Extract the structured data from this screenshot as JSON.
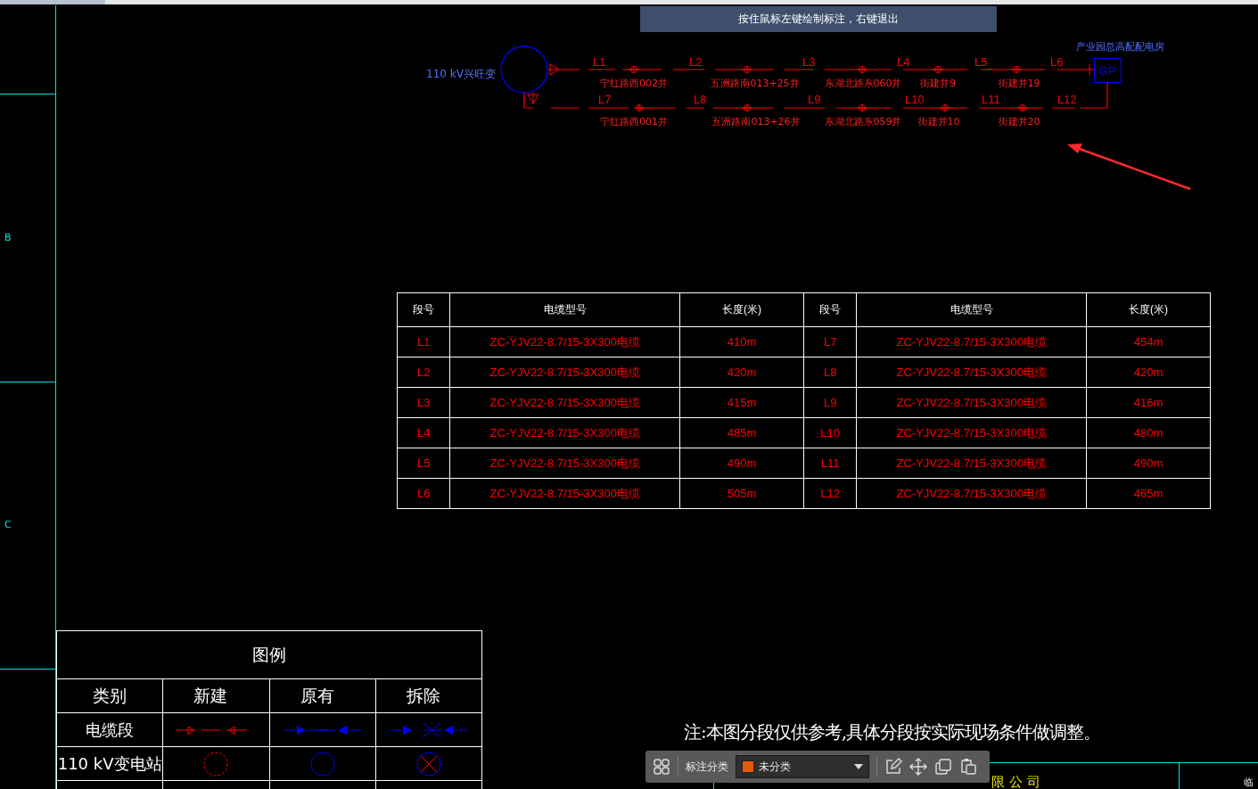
{
  "hint_banner": "按住鼠标左键绘制标注，右键退出",
  "frame": {
    "zone_labels": [
      "B",
      "C"
    ]
  },
  "diagram": {
    "source": "110 kV兴旺变",
    "destination": {
      "label": "产业园总高配配电房",
      "box": "GP"
    },
    "circuits": [
      {
        "segments": [
          "L1",
          "L2",
          "L3",
          "L4",
          "L5",
          "L6"
        ],
        "joints": [
          "宁红路西002井",
          "五洲路南013+25井",
          "东湖北路东060井",
          "街建井9",
          "街建井19"
        ]
      },
      {
        "segments": [
          "L7",
          "L8",
          "L9",
          "L10",
          "L11",
          "L12"
        ],
        "joints": [
          "宁红路西001井",
          "五洲路南013+26井",
          "东湖北路东059井",
          "街建井10",
          "街建井20"
        ]
      }
    ]
  },
  "cable_table": {
    "columns": [
      "段号",
      "电缆型号",
      "长度(米)",
      "段号",
      "电缆型号",
      "长度(米)"
    ],
    "rows": [
      [
        "L1",
        "ZC-YJV22-8.7/15-3X300电缆",
        "410m",
        "L7",
        "ZC-YJV22-8.7/15-3X300电缆",
        "454m"
      ],
      [
        "L2",
        "ZC-YJV22-8.7/15-3X300电缆",
        "420m",
        "L8",
        "ZC-YJV22-8.7/15-3X300电缆",
        "420m"
      ],
      [
        "L3",
        "ZC-YJV22-8.7/15-3X300电缆",
        "415m",
        "L9",
        "ZC-YJV22-8.7/15-3X300电缆",
        "416m"
      ],
      [
        "L4",
        "ZC-YJV22-8.7/15-3X300电缆",
        "485m",
        "L10",
        "ZC-YJV22-8.7/15-3X300电缆",
        "480m"
      ],
      [
        "L5",
        "ZC-YJV22-8.7/15-3X300电缆",
        "490m",
        "L11",
        "ZC-YJV22-8.7/15-3X300电缆",
        "490m"
      ],
      [
        "L6",
        "ZC-YJV22-8.7/15-3X300电缆",
        "505m",
        "L12",
        "ZC-YJV22-8.7/15-3X300电缆",
        "465m"
      ]
    ]
  },
  "legend": {
    "title": "图例",
    "columns": [
      "类别",
      "新建",
      "原有",
      "拆除"
    ],
    "rows": [
      {
        "label": "电缆段",
        "kind": "cable"
      },
      {
        "label": "110 kV变电站",
        "kind": "substation"
      }
    ]
  },
  "note": "注:本图分段仅供参考,具体分段按实际现场条件做调整。",
  "toolbar": {
    "label": "标注分类",
    "category": "未分类"
  },
  "title_block": {
    "company_fragment": "限 公 司",
    "corner_text": "临"
  }
}
